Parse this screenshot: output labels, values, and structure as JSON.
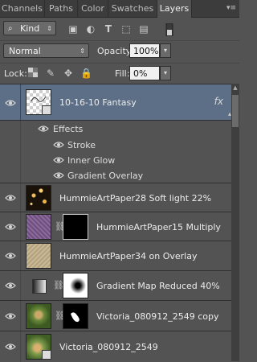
{
  "tabs": [
    "Channels",
    "Paths",
    "Color",
    "Swatches",
    "Layers"
  ],
  "active_tab": "Layers",
  "filter": {
    "kind_label": "Kind"
  },
  "blend": {
    "mode": "Normal",
    "opacity_label": "Opacity:",
    "opacity_value": "100%"
  },
  "lock": {
    "label": "Lock:",
    "fill_label": "Fill:",
    "fill_value": "0%"
  },
  "layers": [
    {
      "name": "10-16-10 Fantasy",
      "selected": true,
      "fx": "fx",
      "effects_label": "Effects",
      "effects": [
        "Stroke",
        "Inner Glow",
        "Gradient Overlay"
      ]
    },
    {
      "name": "HummieArtPaper28 Soft light 22%"
    },
    {
      "name": "HummieArtPaper15 Multiply"
    },
    {
      "name": "HummieArtPaper34 on Overlay"
    },
    {
      "name": "Gradient Map Reduced 40%"
    },
    {
      "name": "Victoria_080912_2549 copy"
    },
    {
      "name": "Victoria_080912_2549"
    }
  ],
  "colors": {
    "panel": "#535353",
    "selected": "#5c6f86",
    "tabbar": "#3c3c3c"
  }
}
